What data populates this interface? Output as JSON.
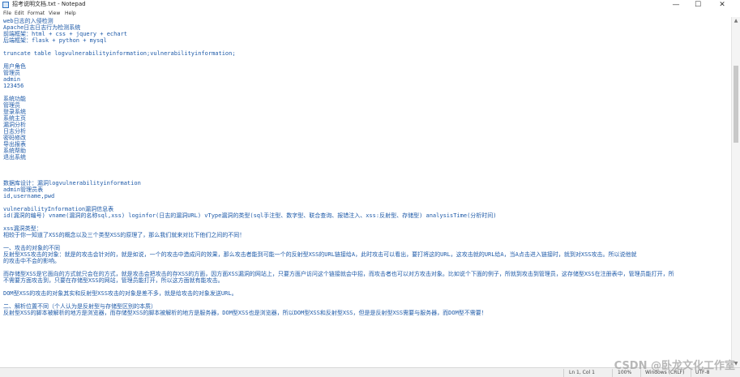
{
  "window": {
    "title": "招考说明文档.txt - Notepad",
    "minimize_label": "—",
    "maximize_label": "☐",
    "close_label": "✕"
  },
  "menu": {
    "items": [
      "File",
      "Edit",
      "Format",
      "View",
      "Help"
    ]
  },
  "lines": [
    {
      "text": "web日志的入侵检测",
      "style": "blue"
    },
    {
      "text": "Apache日志日志行为检测系统",
      "style": "blue"
    },
    {
      "text": "前端框架：html + css   + jquery + echart",
      "style": "blue"
    },
    {
      "text": "后端框架：flask + python + mysql",
      "style": "blue"
    },
    {
      "text": "",
      "style": "blue"
    },
    {
      "text": "truncate table logvulnerabilityinformation;vulnerabilityinformation;",
      "style": "blue"
    },
    {
      "text": "",
      "style": "blue"
    },
    {
      "text": "用户角色",
      "style": "blue"
    },
    {
      "text": "管理员",
      "style": "blue"
    },
    {
      "text": "admin",
      "style": "blue"
    },
    {
      "text": "123456",
      "style": "blue"
    },
    {
      "text": "",
      "style": "blue"
    },
    {
      "text": "系统功能",
      "style": "blue"
    },
    {
      "text": "管理员",
      "style": "blue"
    },
    {
      "text": "登录系统",
      "style": "blue"
    },
    {
      "text": "系统主页",
      "style": "blue"
    },
    {
      "text": "漏洞分析",
      "style": "blue"
    },
    {
      "text": "日志分析",
      "style": "blue"
    },
    {
      "text": "密码修改",
      "style": "blue"
    },
    {
      "text": "导出报表",
      "style": "blue"
    },
    {
      "text": "系统帮助",
      "style": "blue"
    },
    {
      "text": "退出系统",
      "style": "blue"
    },
    {
      "text": "",
      "style": "blue"
    },
    {
      "text": "",
      "style": "blue"
    },
    {
      "text": "",
      "style": "blue"
    },
    {
      "text": "数据库设计：漏洞logvulnerabilityinformation",
      "style": "blue"
    },
    {
      "text": "admin管理员表",
      "style": "blue"
    },
    {
      "text": "id,username,pwd",
      "style": "blue"
    },
    {
      "text": "",
      "style": "blue"
    },
    {
      "text": "vulnerabilityInformation漏洞信息表",
      "style": "blue"
    },
    {
      "text": "id(漏洞的编号) vname(漏洞的名称sql,xss) loginfor(日志的漏洞URL) vType漏洞的类型(sql手注型、数字型、联合查询、报错注入、xss:反射型、存储型) analysisTime(分析时间)",
      "style": "blue"
    },
    {
      "text": "",
      "style": "blue"
    },
    {
      "text": "xss漏洞类型：",
      "style": "blue"
    },
    {
      "text": "相较于你一知道了XSS的概念以及三个类型XSS的原理了，那么我们就来对比下他们之间的不同！",
      "style": "blue"
    },
    {
      "text": "",
      "style": "blue"
    },
    {
      "text": "  一、攻击的对象的不同",
      "style": "blue"
    },
    {
      "text": "反射型XSS攻击的对象：就是的攻击会针对的，就是如说，一个的攻击中造成问的效果，那么攻击者能到可能一个的反射型XSS的URL链接给A，此时攻击可以看出，要打将这的URL，这攻击就的URL给A，当A点击进入链接时，就到对XSS攻击。所以说他就",
      "style": "blue"
    },
    {
      "text": "的攻击中不会的影响。",
      "style": "blue"
    },
    {
      "text": "",
      "style": "blue"
    },
    {
      "text": "而存储型XSS是它面向的方式就只会在的方式，就是攻击会把攻击的存XSS的方面，因方面XSS漏洞的网站上，只要方面户访问这个链接就会中招，而攻击者也可以对方攻击对象。比如说个下面的例子，所就到攻击到管理员，这存储型XSS在注册表中，管理员能打开，所",
      "style": "blue"
    },
    {
      "text": "不需要方面攻击到，只要在存储型XSS的网站，管理员能打开，所以这方面就有能攻击。",
      "style": "blue"
    },
    {
      "text": "",
      "style": "blue"
    },
    {
      "text": "DOM型XSS的攻击的对象其实和反射型XSS攻击的对象是差不多，就是给攻击的对象发送URL。",
      "style": "blue"
    },
    {
      "text": "",
      "style": "blue"
    },
    {
      "text": "  二、解析位置不同（个人认为是反射型与存储型区别的本质）",
      "style": "blue"
    },
    {
      "text": "反射型XSS的脚本被解析的地方是浏览器，而存储型XSS的脚本被解析的地方是服务器，DOM型XSS也是浏览器，所以DOM型XSS和反射型XSS，但是是反射型XSS需要与服务器，而DOM型不需要！",
      "style": "blue"
    }
  ],
  "status": {
    "position": "Ln 1, Col 1",
    "zoom": "100%",
    "line_ending": "Windows (CRLF)",
    "encoding": "UTF-8"
  },
  "watermark": "CSDN @卧龙文化工作室"
}
